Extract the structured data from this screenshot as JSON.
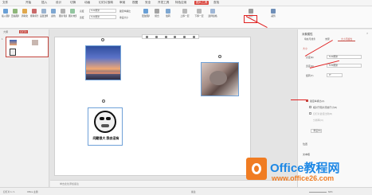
{
  "menu": {
    "items": [
      "文件",
      "开始",
      "插入",
      "设计",
      "切换",
      "动画",
      "幻灯片放映",
      "审阅",
      "视图",
      "安全",
      "开发工具",
      "特色应用",
      "图片工具",
      "查找"
    ],
    "active_index": 12
  },
  "ribbon": {
    "buttons": [
      "插入图片",
      "压缩图片",
      "清晰化",
      "抠除背景",
      "设置透明色",
      "颜色",
      "图片轮廓",
      "图片效果",
      "更改图片",
      "组合",
      "旋转",
      "上移一层",
      "下移一层",
      "选择窗格",
      "对齐",
      "裁剪"
    ],
    "height_value": "5.00厘米",
    "width_value": "5.00厘米",
    "lock_ratio": "锁定纵横比",
    "reset": "重设大小"
  },
  "left_panel": {
    "tab_outline": "大纲",
    "tab_slides": "幻灯片",
    "slide_number": "1"
  },
  "slide": {
    "caption_line1": "问题很大  我去没有",
    "notes_placeholder": "单击此处添加备注"
  },
  "right_panel": {
    "title": "对象属性",
    "tabs": [
      "填充与线条",
      "效果",
      "大小与属性"
    ],
    "section_size": "大小",
    "height_label": "高度(E)",
    "height_value": "5.00厘米",
    "width_label": "宽度(D)",
    "width_value": "5.00厘米",
    "rotate_label": "旋转(T)",
    "rotate_value": "0°",
    "lock_ratio": "锁定纵横比(A)",
    "relative_size": "相对于图片原始尺寸(R)",
    "best_scale": "幻灯片最佳比例(B)",
    "resolution": "分辨率(O)",
    "reset_label": "重设(S)",
    "section_position": "位置",
    "section_text": "文本框"
  },
  "status": {
    "slide_info": "幻灯片 1 / 1",
    "theme": "Office 主题",
    "note_btn": "备注",
    "zoom": "62%"
  },
  "watermark": {
    "brand": "Office教程网",
    "url": "www.office26.com"
  },
  "colors": {
    "accent_red": "#d9443c",
    "watermark_blue": "#1e88e5",
    "watermark_orange": "#f07c22"
  }
}
